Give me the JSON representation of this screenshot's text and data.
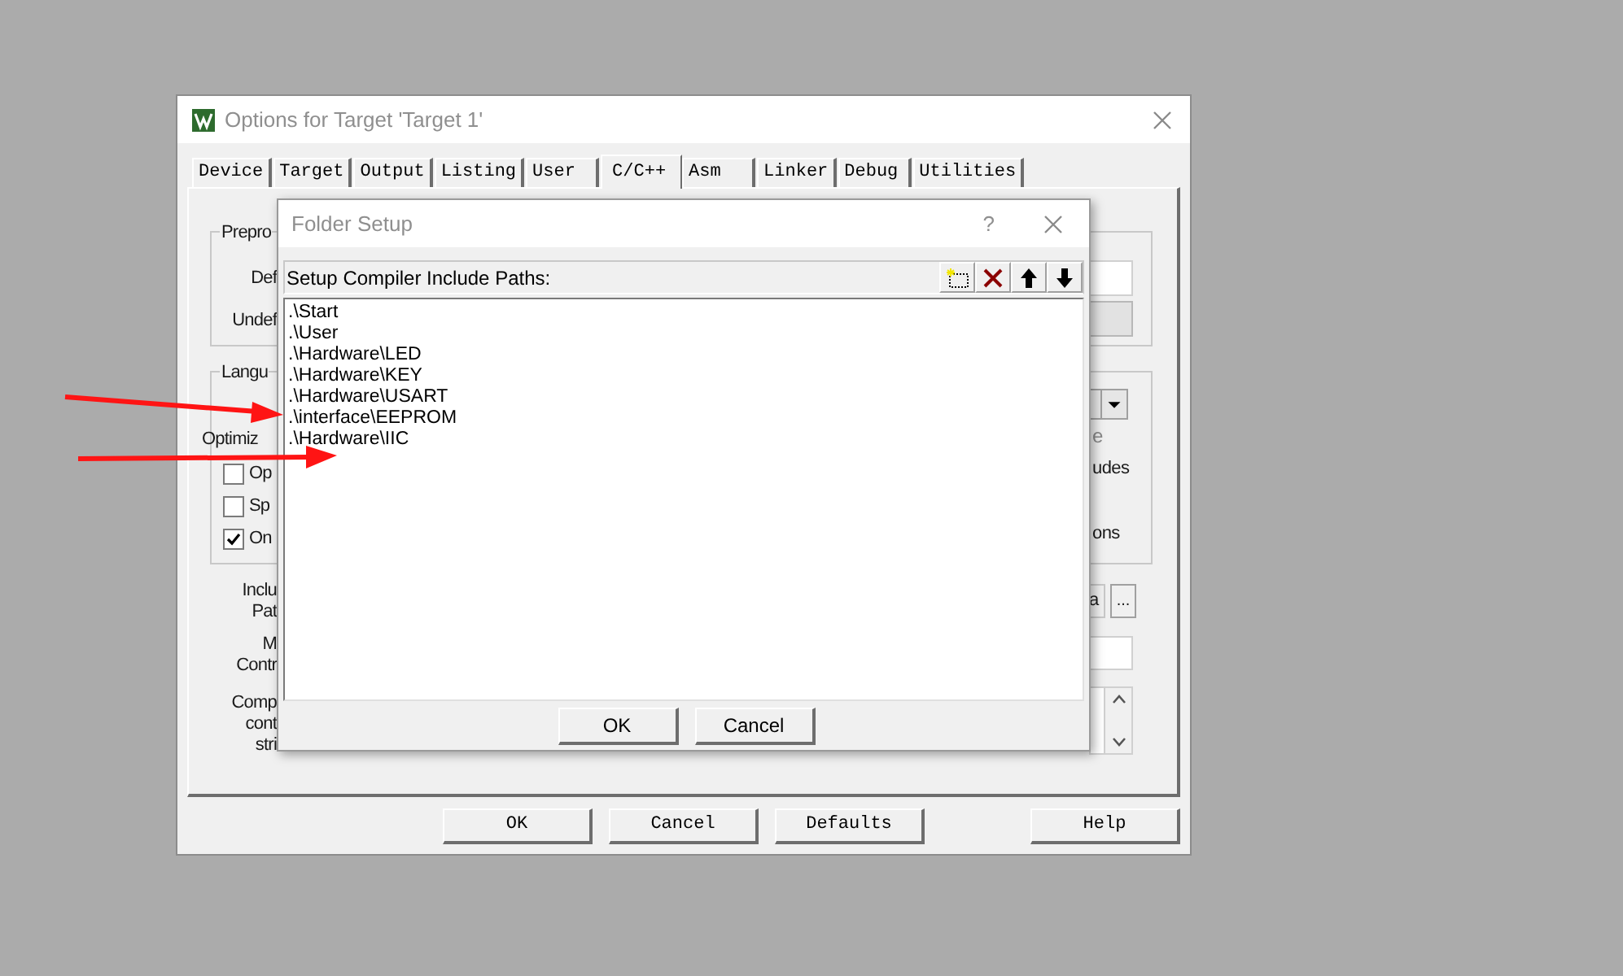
{
  "window": {
    "title": "Options for Target 'Target 1'"
  },
  "tabs": [
    {
      "label": "Device",
      "selected": false
    },
    {
      "label": "Target",
      "selected": false
    },
    {
      "label": "Output",
      "selected": false
    },
    {
      "label": "Listing",
      "selected": false
    },
    {
      "label": "User",
      "selected": false
    },
    {
      "label": "C/C++",
      "selected": true
    },
    {
      "label": "Asm",
      "selected": false
    },
    {
      "label": "Linker",
      "selected": false
    },
    {
      "label": "Debug",
      "selected": false
    },
    {
      "label": "Utilities",
      "selected": false
    }
  ],
  "preprocessor": {
    "legend": "Prepro",
    "fields": [
      {
        "label": "Def",
        "disabled": false
      },
      {
        "label": "Undef",
        "disabled": true
      }
    ]
  },
  "language": {
    "legend": "Langu",
    "optimization": {
      "label": "Optimiz",
      "hint": "e"
    },
    "options": [
      {
        "label": "Op",
        "checked": false,
        "tail": "udes"
      },
      {
        "label": "Sp",
        "checked": false
      },
      {
        "label": "On",
        "checked": true,
        "tail": "ons"
      }
    ]
  },
  "include_paths": {
    "label_lines": [
      "Inclu",
      "Pat"
    ],
    "value": "a",
    "browse": "..."
  },
  "misc_controls": {
    "label_lines": [
      "M",
      "Contr"
    ]
  },
  "compiler_control_string": {
    "label_lines": [
      "Comp",
      "cont",
      "stri"
    ]
  },
  "buttons": [
    "OK",
    "Cancel",
    "Defaults",
    "Help"
  ],
  "folder_setup": {
    "title": "Folder Setup",
    "help": "?",
    "header": "Setup Compiler Include Paths:",
    "paths": [
      ".\\Start",
      ".\\User",
      ".\\Hardware\\LED",
      ".\\Hardware\\KEY",
      ".\\Hardware\\USART",
      ".\\interface\\EEPROM",
      ".\\Hardware\\IIC"
    ],
    "buttons": [
      "OK",
      "Cancel"
    ]
  }
}
